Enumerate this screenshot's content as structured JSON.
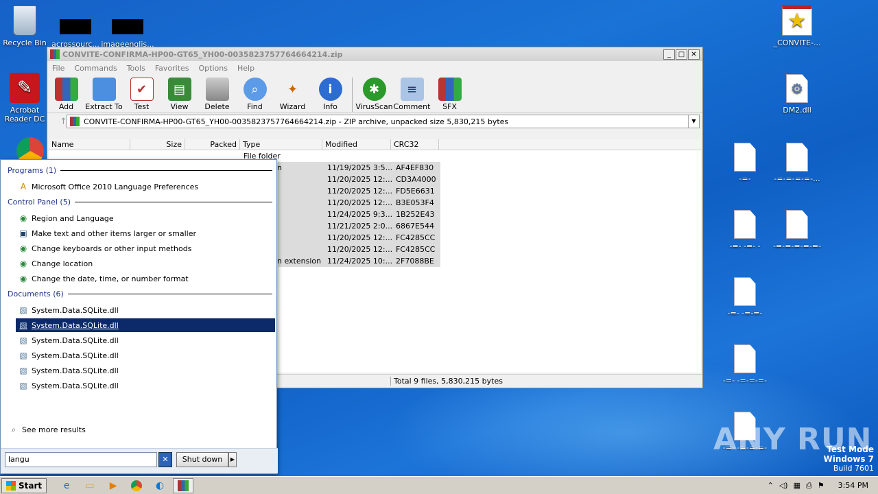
{
  "desktop": {
    "icons_left": [
      {
        "label": "Recycle Bin"
      },
      {
        "label": "acrossourc..."
      },
      {
        "label": "imageenglis..."
      },
      {
        "label": "Acrobat Reader DC"
      }
    ],
    "icons_right": [
      {
        "label": "_CONVITE-..."
      },
      {
        "label": "DM2.dll"
      },
      {
        "label": "-=-"
      },
      {
        "label": "-=-=-=-=-..."
      },
      {
        "label": "-=- -=- -"
      },
      {
        "label": "-=-=-=-=-=-"
      },
      {
        "label": "-=- -=-=-"
      },
      {
        "label": "-=- -=-=-=-"
      },
      {
        "label": "-=- -=-=-=-"
      }
    ]
  },
  "winrar": {
    "title": "CONVITE-CONFIRMA-HP00-GT65_YH00-0035823757764664214.zip",
    "menu": [
      "File",
      "Commands",
      "Tools",
      "Favorites",
      "Options",
      "Help"
    ],
    "toolbar": [
      {
        "label": "Add",
        "icon": "books-icon"
      },
      {
        "label": "Extract To",
        "icon": "folder-icon"
      },
      {
        "label": "Test",
        "icon": "checklist-icon"
      },
      {
        "label": "View",
        "icon": "book-icon"
      },
      {
        "label": "Delete",
        "icon": "trash-icon"
      },
      {
        "label": "Find",
        "icon": "magnifier-icon"
      },
      {
        "label": "Wizard",
        "icon": "wand-icon"
      },
      {
        "label": "Info",
        "icon": "info-icon"
      },
      {
        "label": "VirusScan",
        "icon": "bug-icon"
      },
      {
        "label": "Comment",
        "icon": "comment-icon"
      },
      {
        "label": "SFX",
        "icon": "sfx-icon"
      }
    ],
    "address": "CONVITE-CONFIRMA-HP00-GT65_YH00-0035823757764664214.zip - ZIP archive, unpacked size 5,830,215 bytes",
    "columns": [
      "Name",
      "Size",
      "Packed",
      "Type",
      "Modified",
      "CRC32"
    ],
    "first_row_type": "File folder",
    "rows": [
      {
        "type_tail": "n",
        "modified": "11/19/2025 3:5...",
        "crc": "AF4EF830"
      },
      {
        "type_tail": "",
        "modified": "11/20/2025 12:...",
        "crc": "CD3A4000"
      },
      {
        "type_tail": "",
        "modified": "11/20/2025 12:...",
        "crc": "FD5E6631"
      },
      {
        "type_tail": "",
        "modified": "11/20/2025 12:...",
        "crc": "B3E053F4"
      },
      {
        "type_tail": "",
        "modified": "11/24/2025 9:3...",
        "crc": "1B252E43"
      },
      {
        "type_tail": "",
        "modified": "11/21/2025 2:0...",
        "crc": "6867E544"
      },
      {
        "type_tail": "",
        "modified": "11/20/2025 12:...",
        "crc": "FC4285CC"
      },
      {
        "type_tail": "",
        "modified": "11/20/2025 12:...",
        "crc": "FC4285CC"
      },
      {
        "type_tail": "n extension",
        "modified": "11/24/2025 10:...",
        "crc": "2F7088BE"
      }
    ],
    "status": "Total 9 files, 5,830,215 bytes"
  },
  "startmenu": {
    "programs_header": "Programs (1)",
    "programs": [
      "Microsoft Office 2010 Language Preferences"
    ],
    "control_header": "Control Panel (5)",
    "control": [
      "Region and Language",
      "Make text and other items larger or smaller",
      "Change keyboards or other input methods",
      "Change location",
      "Change the date, time, or number format"
    ],
    "documents_header": "Documents (6)",
    "documents": [
      "System.Data.SQLite.dll",
      "System.Data.SQLite.dll",
      "System.Data.SQLite.dll",
      "System.Data.SQLite.dll",
      "System.Data.SQLite.dll",
      "System.Data.SQLite.dll"
    ],
    "see_more": "See more results",
    "search_value": "langu",
    "shutdown": "Shut down"
  },
  "taskbar": {
    "start": "Start",
    "clock": "3:54 PM"
  },
  "watermark": "ANY RUN",
  "testmode": {
    "l1": "Test Mode",
    "l2": "Windows 7",
    "l3": "Build 7601"
  }
}
